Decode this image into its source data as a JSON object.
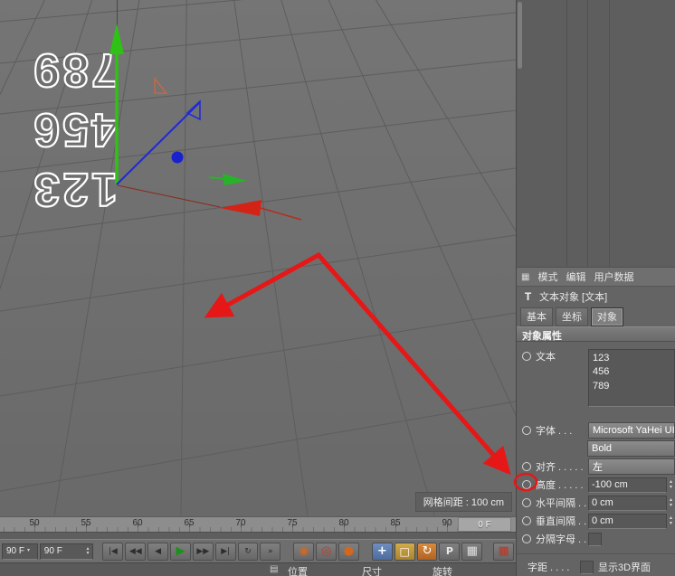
{
  "colors": {
    "annotation_red": "#e61717",
    "axis_green": "#2ec214",
    "axis_blue": "#1f2ad8",
    "axis_red": "#d42316",
    "play_green": "#1d8f1d"
  },
  "viewport": {
    "grid_spacing_label": "网格间距 : 100 cm"
  },
  "text_object": {
    "lines": [
      "123",
      "456",
      "789"
    ]
  },
  "timeline": {
    "ticks": [
      "50",
      "55",
      "60",
      "65",
      "70",
      "75",
      "80",
      "85",
      "90"
    ],
    "current_frame": "0 F"
  },
  "transport": {
    "start_frame": "90 F",
    "end_frame": "90 F",
    "play_buttons": [
      {
        "name": "goto-start",
        "glyph": "|◀"
      },
      {
        "name": "prev-key",
        "glyph": "◀◀"
      },
      {
        "name": "prev-frame",
        "glyph": "◀"
      },
      {
        "name": "play",
        "glyph": "▶"
      },
      {
        "name": "next-frame",
        "glyph": "▶▶"
      },
      {
        "name": "next-key",
        "glyph": "▶|"
      },
      {
        "name": "loop",
        "glyph": "↻"
      },
      {
        "name": "goto-end",
        "glyph": "»"
      }
    ],
    "record_buttons": [
      {
        "name": "record-keyframe",
        "glyph": "◉"
      },
      {
        "name": "autokey",
        "glyph": "◎"
      },
      {
        "name": "record-options",
        "glyph": "●"
      }
    ],
    "toggle_buttons": [
      {
        "name": "record-position",
        "glyph": "+"
      },
      {
        "name": "record-scale",
        "glyph": "□"
      },
      {
        "name": "record-rotation",
        "glyph": "↻"
      },
      {
        "name": "record-parameter",
        "glyph": "P"
      },
      {
        "name": "record-pla",
        "glyph": "▦"
      }
    ],
    "extra_button": {
      "name": "motion-mode",
      "glyph": "▦"
    }
  },
  "coordinate_bar": {
    "icon": "▤",
    "labels": [
      "位置",
      "尺寸",
      "旋转"
    ]
  },
  "panel": {
    "menu": {
      "icon": "▦",
      "items": [
        "模式",
        "编辑",
        "用户数据"
      ]
    },
    "object": {
      "icon": "T",
      "title": "文本对象 [文本]"
    },
    "tabs": [
      "基本",
      "坐标",
      "对象"
    ],
    "active_tab": "对象",
    "section_title": "对象属性",
    "rows": {
      "text_label": "文本",
      "font_label": "字体 . . .",
      "font_name": "Microsoft YaHei UI",
      "font_style": "Bold",
      "align_label": "对齐 . . . . .",
      "align_value": "左",
      "height_label": "高度 . . . . .",
      "height_value": "-100 cm",
      "hgap_label": "水平间隔 . .",
      "hgap_value": "0 cm",
      "vgap_label": "垂直间隔 . .",
      "vgap_value": "0 cm",
      "separate_label": "分隔字母 . .",
      "kerning_label": "字距 . . . .",
      "kerning_checkbox_label": "显示3D界面"
    }
  }
}
